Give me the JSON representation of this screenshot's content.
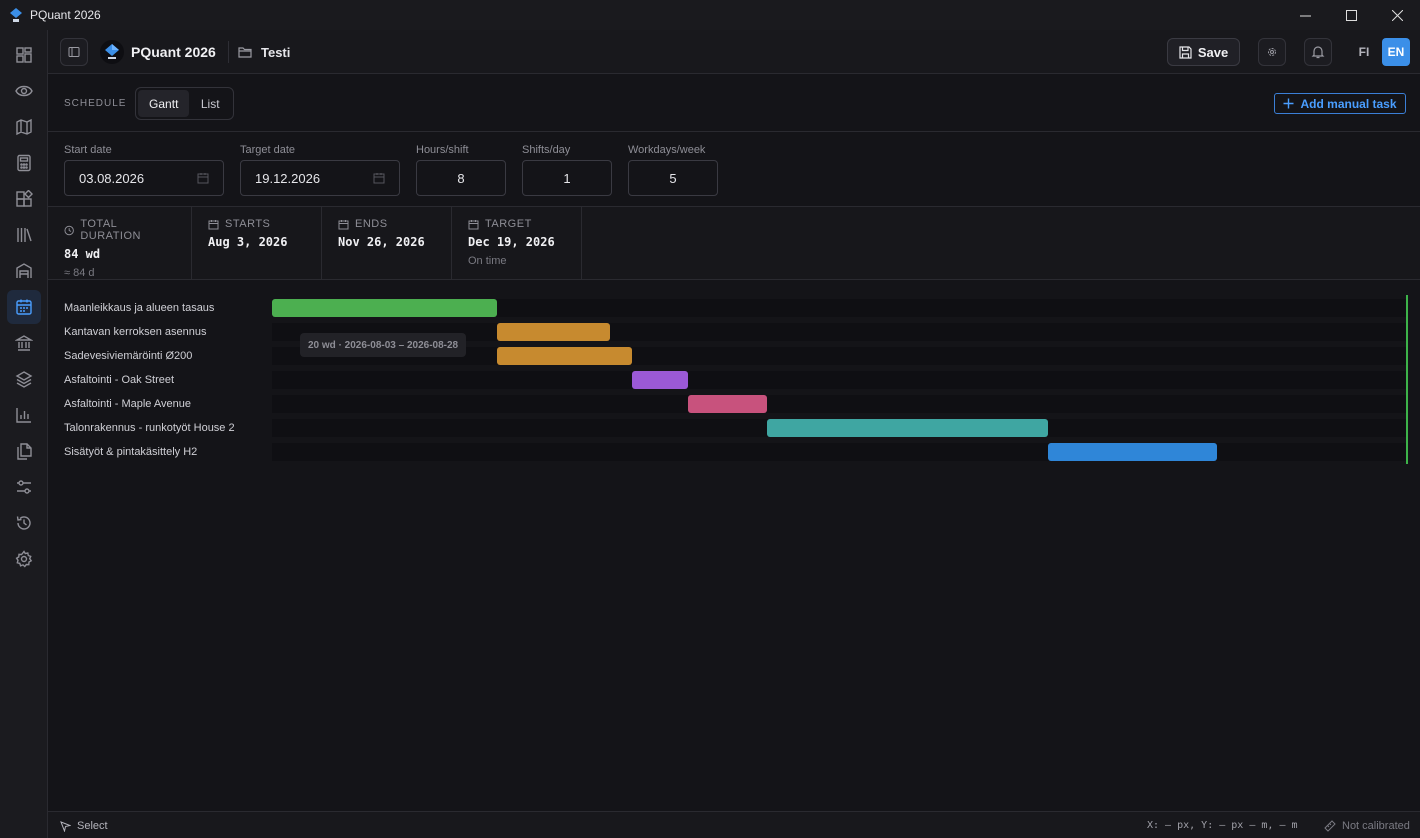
{
  "window": {
    "title": "PQuant 2026",
    "minimize": "—",
    "maximize": "☐",
    "close": "✕"
  },
  "header": {
    "brand": "PQuant 2026",
    "project": "Testi",
    "save_label": "Save",
    "lang_fi": "FI",
    "lang_en": "EN",
    "active_lang": "EN"
  },
  "schedule": {
    "section_label": "SCHEDULE",
    "view_gantt": "Gantt",
    "view_list": "List",
    "active_view": "Gantt",
    "add_task_label": "Add manual task"
  },
  "form": {
    "start_date": {
      "label": "Start date",
      "value": "03.08.2026"
    },
    "target_date": {
      "label": "Target date",
      "value": "19.12.2026"
    },
    "hours_shift": {
      "label": "Hours/shift",
      "value": "8"
    },
    "shifts_day": {
      "label": "Shifts/day",
      "value": "1"
    },
    "workdays_week": {
      "label": "Workdays/week",
      "value": "5"
    }
  },
  "stats": {
    "total": {
      "label": "TOTAL DURATION",
      "value": "84 wd",
      "sub": "≈ 84 d"
    },
    "starts": {
      "label": "STARTS",
      "value": "Aug 3, 2026"
    },
    "ends": {
      "label": "ENDS",
      "value": "Nov 26, 2026"
    },
    "target": {
      "label": "TARGET",
      "value": "Dec 19, 2026",
      "sub": "On time"
    }
  },
  "gantt": {
    "tooltip": "20 wd · 2026-08-03 – 2026-08-28",
    "tasks": [
      {
        "name": "Maanleikkaus ja alueen tasaus",
        "color": "#4caf50"
      },
      {
        "name": "Kantavan kerroksen asennus",
        "color": "#c78a2f"
      },
      {
        "name": "Sadevesiviemäröinti Ø200",
        "color": "#c78a2f"
      },
      {
        "name": "Asfaltointi - Oak Street",
        "color": "#9b59d6"
      },
      {
        "name": "Asfaltointi - Maple Avenue",
        "color": "#c8527d"
      },
      {
        "name": "Talonrakennus - runkotyöt House 2",
        "color": "#3fa6a2"
      },
      {
        "name": "Sisätyöt & pintakäsittely H2",
        "color": "#2f86d8"
      }
    ]
  },
  "status": {
    "mode": "Select",
    "coords": "X: — px, Y: — px — m, — m",
    "calibration": "Not calibrated"
  },
  "colors": {
    "accent": "#3b8fe8",
    "target_line": "#3db34a"
  }
}
